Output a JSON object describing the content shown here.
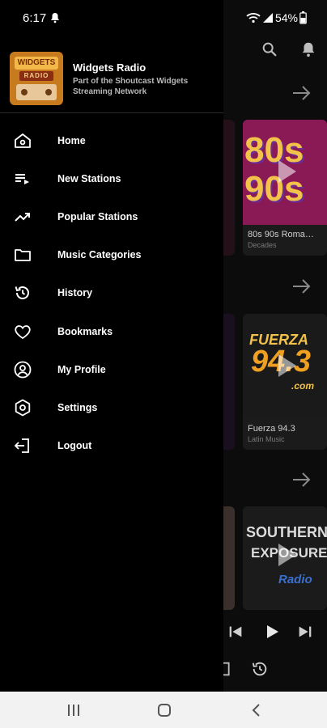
{
  "status_bar": {
    "time": "6:17",
    "battery_percent": "54%",
    "icons": [
      "notification-icon",
      "wifi-icon",
      "signal-icon",
      "battery-icon"
    ]
  },
  "drawer": {
    "app_name": "Widgets Radio",
    "tagline": "Part of the Shoutcast Widgets Streaming Network",
    "logo": {
      "line1": "WIDGETS",
      "line2": "RADIO"
    },
    "items": [
      {
        "label": "Home",
        "icon": "home-icon"
      },
      {
        "label": "New Stations",
        "icon": "playlist-add-icon"
      },
      {
        "label": "Popular Stations",
        "icon": "trending-up-icon"
      },
      {
        "label": "Music Categories",
        "icon": "folder-icon"
      },
      {
        "label": "History",
        "icon": "history-icon"
      },
      {
        "label": "Bookmarks",
        "icon": "heart-icon"
      },
      {
        "label": "My Profile",
        "icon": "profile-icon"
      },
      {
        "label": "Settings",
        "icon": "settings-icon"
      },
      {
        "label": "Logout",
        "icon": "logout-icon"
      }
    ]
  },
  "background": {
    "cards": [
      {
        "title": "80s 90s Roma…",
        "subtitle": "Decades",
        "art": "80s 90s"
      },
      {
        "title": "Fuerza 94.3",
        "subtitle": "Latin Music",
        "art_line1": "FUERZA",
        "art_line2": "94.3",
        "art_line3": ".com"
      },
      {
        "art_line1": "SOUTHERN",
        "art_line2": "EXPOSURE",
        "art_line3": "Radio"
      }
    ]
  },
  "colors": {
    "drawer_bg": "#000000",
    "nav_bar_bg": "#f2f2f2",
    "logo_orange": "#c77a1e"
  }
}
